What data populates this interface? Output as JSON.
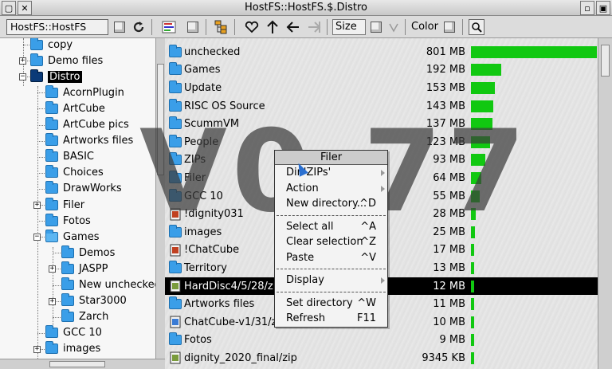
{
  "window": {
    "title": "HostFS::HostFS.$.Distro"
  },
  "toolbar": {
    "path": "HostFS::HostFS",
    "size_label": "Size",
    "color_label": "Color",
    "icons": [
      "refresh-icon",
      "list-view-icon",
      "zip-icon",
      "tree-icon",
      "favourite-icon",
      "up-icon",
      "back-icon",
      "forward-icon",
      "search-icon"
    ]
  },
  "tree": {
    "items": [
      {
        "label": "copy"
      },
      {
        "label": "Demo files",
        "expander": "+"
      },
      {
        "label": "Distro",
        "expander": "-",
        "selected": true
      },
      {
        "label": "AcornPlugin"
      },
      {
        "label": "ArtCube"
      },
      {
        "label": "ArtCube pics"
      },
      {
        "label": "Artworks files"
      },
      {
        "label": "BASIC"
      },
      {
        "label": "Choices"
      },
      {
        "label": "DrawWorks"
      },
      {
        "label": "Filer",
        "expander": "+"
      },
      {
        "label": "Fotos"
      },
      {
        "label": "Games",
        "expander": "-"
      },
      {
        "label": "Demos"
      },
      {
        "label": "JASPP",
        "expander": "+"
      },
      {
        "label": "New unchecked"
      },
      {
        "label": "Star3000",
        "expander": "+"
      },
      {
        "label": "Zarch"
      },
      {
        "label": "GCC 10"
      },
      {
        "label": "images",
        "expander": "+"
      }
    ]
  },
  "files": [
    {
      "name": "unchecked",
      "size": "801 MB",
      "fraction": 1.0,
      "icon": "folder"
    },
    {
      "name": "Games",
      "size": "192 MB",
      "fraction": 0.24,
      "icon": "folder"
    },
    {
      "name": "Update",
      "size": "153 MB",
      "fraction": 0.19,
      "icon": "folder"
    },
    {
      "name": "RISC OS Source",
      "size": "143 MB",
      "fraction": 0.178,
      "icon": "folder"
    },
    {
      "name": "ScummVM",
      "size": "137 MB",
      "fraction": 0.171,
      "icon": "folder"
    },
    {
      "name": "People",
      "size": "123 MB",
      "fraction": 0.153,
      "icon": "folder"
    },
    {
      "name": "ZIPs",
      "size": "93 MB",
      "fraction": 0.116,
      "icon": "folder"
    },
    {
      "name": "Filer",
      "size": "64 MB",
      "fraction": 0.08,
      "icon": "folder"
    },
    {
      "name": "GCC 10",
      "size": "55 MB",
      "fraction": 0.069,
      "icon": "folder"
    },
    {
      "name": "!dignity031",
      "size": "28 MB",
      "fraction": 0.035,
      "icon": "app"
    },
    {
      "name": "images",
      "size": "25 MB",
      "fraction": 0.031,
      "icon": "folder"
    },
    {
      "name": "!ChatCube",
      "size": "17 MB",
      "fraction": 0.021,
      "icon": "app"
    },
    {
      "name": "Territory",
      "size": "13 MB",
      "fraction": 0.016,
      "icon": "folder"
    },
    {
      "name": "HardDisc4/5/28/zip",
      "size": "12 MB",
      "fraction": 0.015,
      "icon": "zip",
      "selected": true
    },
    {
      "name": "Artworks files",
      "size": "11 MB",
      "fraction": 0.014,
      "icon": "folder"
    },
    {
      "name": "ChatCube-v1/31/zip",
      "size": "10 MB",
      "fraction": 0.012,
      "icon": "doc"
    },
    {
      "name": "Fotos",
      "size": "9 MB",
      "fraction": 0.011,
      "icon": "folder"
    },
    {
      "name": "dignity_2020_final/zip",
      "size": "9345 KB",
      "fraction": 0.011,
      "icon": "zip"
    }
  ],
  "watermark": "V0.77",
  "menu": {
    "title": "Filer",
    "items": [
      {
        "label": "Dir.'ZIPs'",
        "shortcut": "",
        "submenu": true
      },
      {
        "label": "Action",
        "shortcut": "",
        "submenu": true
      },
      {
        "label": "New directory...",
        "shortcut": "^D",
        "separator_after": true
      },
      {
        "label": "Select all",
        "shortcut": "^A"
      },
      {
        "label": "Clear selection",
        "shortcut": "^Z"
      },
      {
        "label": "Paste",
        "shortcut": "^V",
        "separator_after": true
      },
      {
        "label": "Display",
        "shortcut": "",
        "submenu": true,
        "separator_after": true
      },
      {
        "label": "Set directory",
        "shortcut": "^W"
      },
      {
        "label": "Refresh",
        "shortcut": "F11"
      }
    ]
  },
  "colors": {
    "bar": "#11c811",
    "selection": "#000000",
    "folder": "#3a9ee8"
  }
}
